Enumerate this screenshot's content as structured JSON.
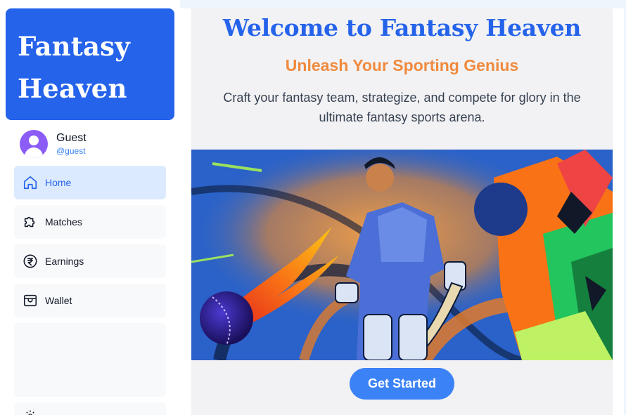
{
  "brand": {
    "line1": "Fantasy",
    "line2": "Heaven"
  },
  "profile": {
    "name": "Guest",
    "handle": "@guest"
  },
  "nav": [
    {
      "label": "Home",
      "icon": "home-icon",
      "active": true
    },
    {
      "label": "Matches",
      "icon": "puzzle-icon",
      "active": false
    },
    {
      "label": "Earnings",
      "icon": "rupee-icon",
      "active": false
    },
    {
      "label": "Wallet",
      "icon": "wallet-icon",
      "active": false
    }
  ],
  "hero": {
    "title": "Welcome to Fantasy Heaven",
    "subtitle": "Unleash Your Sporting Genius",
    "description": "Craft your fantasy team, strategize, and compete for glory in the ultimate fantasy sports arena.",
    "cta": "Get Started"
  },
  "colors": {
    "primary": "#2563eb",
    "accent": "#f08a3e",
    "button": "#3b82f6",
    "avatar": "#8b5cf6",
    "active_nav_bg": "#dbeafe"
  }
}
